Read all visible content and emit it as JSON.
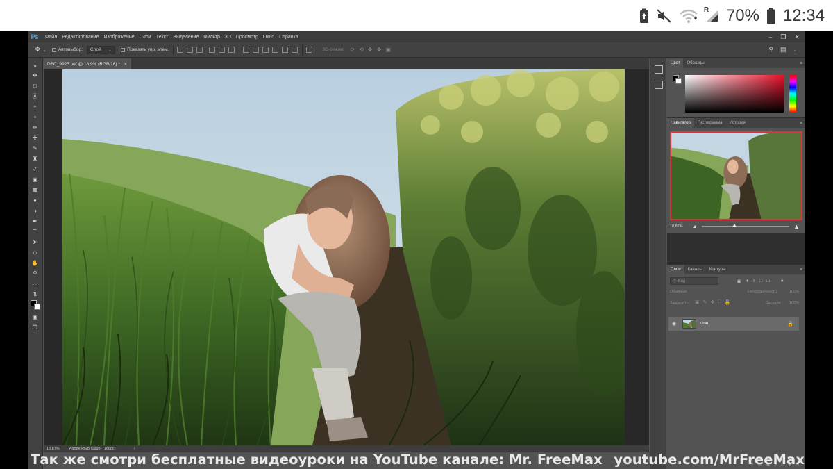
{
  "status_bar": {
    "battery_percent": "70%",
    "time": "12:34",
    "roaming_label": "R",
    "icons": [
      "battery-saver-icon",
      "mute-icon",
      "wifi-icon",
      "signal-icon",
      "battery-icon"
    ]
  },
  "app": {
    "logo": "Ps",
    "menu": [
      "Файл",
      "Редактирование",
      "Изображение",
      "Слои",
      "Текст",
      "Выделение",
      "Фильтр",
      "3D",
      "Просмотр",
      "Окно",
      "Справка"
    ],
    "options_bar": {
      "auto_select_label": "Автовыбор:",
      "auto_select_value": "Слой",
      "show_transform_label": "Показать упр. элем.",
      "mode_3d_label": "3D-режим:"
    },
    "document": {
      "tab_title": "DSC_9925.nef @ 18,9% (RGB/16) *",
      "zoom": "18,87%",
      "profile": "Adobe RGB (1998) (16bpc)"
    },
    "color_panel": {
      "tabs": [
        "Цвет",
        "Образцы"
      ],
      "active_tab": "Цвет",
      "foreground": "#000000",
      "background": "#ffffff",
      "hue": "#e8102a"
    },
    "navigator_panel": {
      "tabs": [
        "Навигатор",
        "Гистограмма",
        "История"
      ],
      "active_tab": "Навигатор",
      "zoom": "18,87%",
      "view_box_color": "#e0303a"
    },
    "layers_panel": {
      "tabs": [
        "Слои",
        "Каналы",
        "Контуры"
      ],
      "active_tab": "Слои",
      "search_placeholder": "Вид",
      "blend_mode": "Обычные",
      "opacity_label": "Непрозрачность:",
      "opacity_value": "100%",
      "lock_label": "Закрепить:",
      "fill_label": "Заливка:",
      "fill_value": "100%",
      "layers": [
        {
          "name": "Фон",
          "visible": true,
          "locked": true
        }
      ]
    }
  },
  "caption": {
    "left": "Так же смотри бесплатные видеоуроки на YouTube канале: Mr. FreeMax",
    "right": "youtube.com/MrFreeMax"
  }
}
